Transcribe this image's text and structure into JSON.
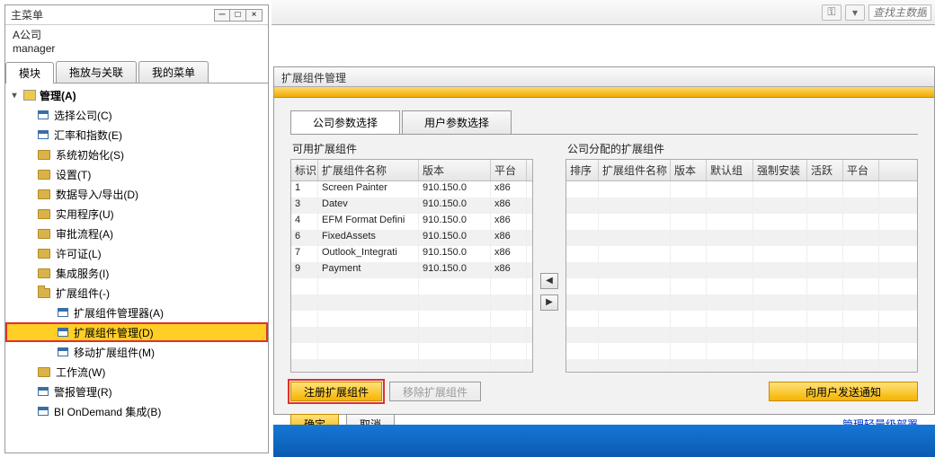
{
  "leftPanel": {
    "title": "主菜单",
    "company": "A公司",
    "user": "manager",
    "tabs": [
      "模块",
      "拖放与关联",
      "我的菜单"
    ],
    "activeTab": 0,
    "rootLabel": "管理(A)",
    "items": [
      {
        "label": "选择公司(C)",
        "icon": "form"
      },
      {
        "label": "汇率和指数(E)",
        "icon": "form"
      },
      {
        "label": "系统初始化(S)",
        "icon": "folder"
      },
      {
        "label": "设置(T)",
        "icon": "folder"
      },
      {
        "label": "数据导入/导出(D)",
        "icon": "folder"
      },
      {
        "label": "实用程序(U)",
        "icon": "folder"
      },
      {
        "label": "审批流程(A)",
        "icon": "folder"
      },
      {
        "label": "许可证(L)",
        "icon": "folder"
      },
      {
        "label": "集成服务(I)",
        "icon": "folder"
      },
      {
        "label": "扩展组件(-)",
        "icon": "folder",
        "open": true,
        "children": [
          {
            "label": "扩展组件管理器(A)",
            "icon": "form"
          },
          {
            "label": "扩展组件管理(D)",
            "icon": "form",
            "selected": true,
            "highlighted": true
          },
          {
            "label": "移动扩展组件(M)",
            "icon": "form"
          }
        ]
      },
      {
        "label": "工作流(W)",
        "icon": "folder"
      },
      {
        "label": "警报管理(R)",
        "icon": "form"
      },
      {
        "label": "BI OnDemand 集成(B)",
        "icon": "form"
      }
    ]
  },
  "toolbar": {
    "searchPlaceholder": "查找主数据和"
  },
  "contentWindow": {
    "title": "扩展组件管理",
    "tabs": [
      "公司参数选择",
      "用户参数选择"
    ],
    "activeTab": 0,
    "leftTable": {
      "title": "可用扩展组件",
      "headers": [
        "标识",
        "扩展组件名称",
        "版本",
        "平台"
      ],
      "rows": [
        [
          "1",
          "Screen Painter",
          "910.150.0",
          "x86"
        ],
        [
          "3",
          "Datev",
          "910.150.0",
          "x86"
        ],
        [
          "4",
          "EFM Format Defini",
          "910.150.0",
          "x86"
        ],
        [
          "6",
          "FixedAssets",
          "910.150.0",
          "x86"
        ],
        [
          "7",
          "Outlook_Integrati",
          "910.150.0",
          "x86"
        ],
        [
          "9",
          "Payment",
          "910.150.0",
          "x86"
        ]
      ]
    },
    "rightTable": {
      "title": "公司分配的扩展组件",
      "headers": [
        "排序",
        "扩展组件名称",
        "版本",
        "默认组",
        "强制安装",
        "活跃",
        "平台"
      ],
      "rows": []
    },
    "buttons": {
      "register": "注册扩展组件",
      "remove": "移除扩展组件",
      "notify": "向用户发送通知",
      "ok": "确定",
      "cancel": "取消"
    },
    "link": "管理轻量级部署"
  }
}
